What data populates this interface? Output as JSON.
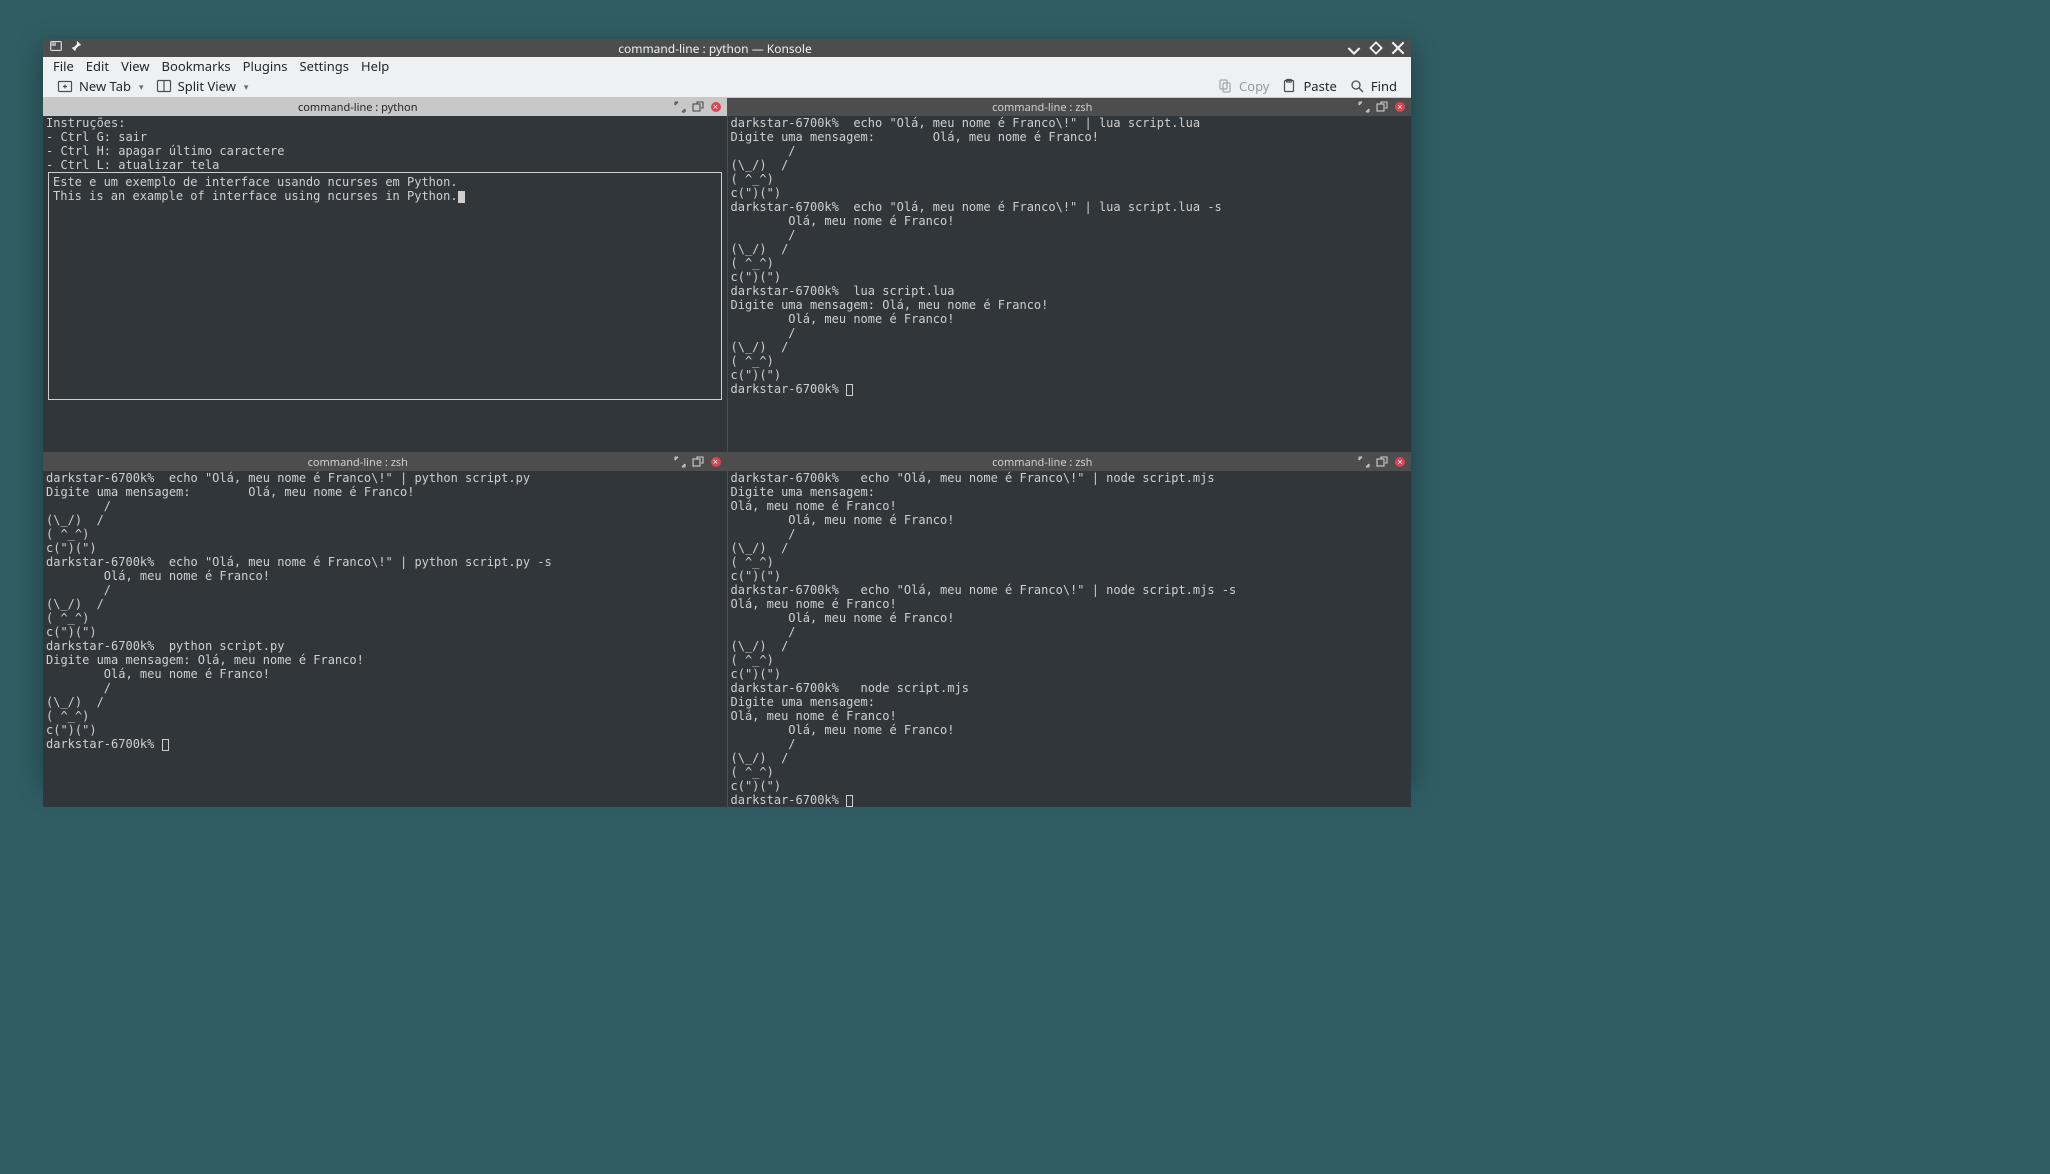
{
  "title": "command-line : python — Konsole",
  "menu": {
    "file": "File",
    "edit": "Edit",
    "view": "View",
    "bookmarks": "Bookmarks",
    "plugins": "Plugins",
    "settings": "Settings",
    "help": "Help"
  },
  "toolbar": {
    "new_tab": "New Tab",
    "split_view": "Split View",
    "copy": "Copy",
    "paste": "Paste",
    "find": "Find"
  },
  "panes": {
    "top_left": {
      "title": "command-line : python",
      "header_text": "Instruções:\n- Ctrl G: sair\n- Ctrl H: apagar último caractere\n- Ctrl L: atualizar tela",
      "box_text": "Este e um exemplo de interface usando ncurses em Python.\nThis is an example of interface using ncurses in Python."
    },
    "top_right": {
      "title": "command-line : zsh",
      "body": "darkstar-6700k%  echo \"Olá, meu nome é Franco\\!\" | lua script.lua\nDigite uma mensagem:        Olá, meu nome é Franco!\n        /\n(\\_/)  /\n( ^_^)\nc(\")(\")\ndarkstar-6700k%  echo \"Olá, meu nome é Franco\\!\" | lua script.lua -s\n        Olá, meu nome é Franco!\n        /\n(\\_/)  /\n( ^_^)\nc(\")(\")\ndarkstar-6700k%  lua script.lua\nDigite uma mensagem: Olá, meu nome é Franco!\n        Olá, meu nome é Franco!\n        /\n(\\_/)  /\n( ^_^)\nc(\")(\")\ndarkstar-6700k% "
    },
    "bottom_left": {
      "title": "command-line : zsh",
      "body": "darkstar-6700k%  echo \"Olá, meu nome é Franco\\!\" | python script.py\nDigite uma mensagem:        Olá, meu nome é Franco!\n        /\n(\\_/)  /\n( ^_^)\nc(\")(\")\ndarkstar-6700k%  echo \"Olá, meu nome é Franco\\!\" | python script.py -s\n        Olá, meu nome é Franco!\n        /\n(\\_/)  /\n( ^_^)\nc(\")(\")\ndarkstar-6700k%  python script.py\nDigite uma mensagem: Olá, meu nome é Franco!\n        Olá, meu nome é Franco!\n        /\n(\\_/)  /\n( ^_^)\nc(\")(\")\ndarkstar-6700k% "
    },
    "bottom_right": {
      "title": "command-line : zsh",
      "body": "darkstar-6700k%   echo \"Olá, meu nome é Franco\\!\" | node script.mjs\nDigite uma mensagem:\nOlá, meu nome é Franco!\n        Olá, meu nome é Franco!\n        /\n(\\_/)  /\n( ^_^)\nc(\")(\")\ndarkstar-6700k%   echo \"Olá, meu nome é Franco\\!\" | node script.mjs -s\nOlá, meu nome é Franco!\n        Olá, meu nome é Franco!\n        /\n(\\_/)  /\n( ^_^)\nc(\")(\")\ndarkstar-6700k%   node script.mjs\nDigite uma mensagem:\nOlá, meu nome é Franco!\n        Olá, meu nome é Franco!\n        /\n(\\_/)  /\n( ^_^)\nc(\")(\")\ndarkstar-6700k% "
    }
  }
}
